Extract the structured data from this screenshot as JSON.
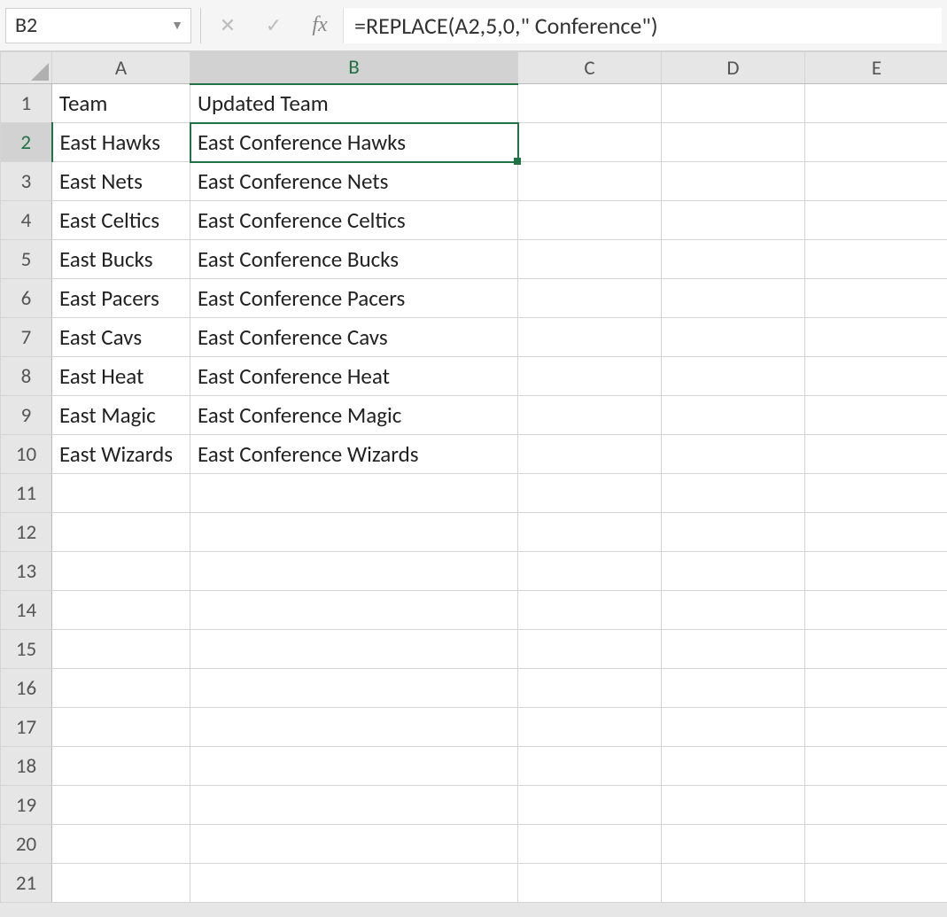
{
  "name_box": "B2",
  "formula": "=REPLACE(A2,5,0,\" Conference\")",
  "fx_label": "fx",
  "columns": [
    "A",
    "B",
    "C",
    "D",
    "E"
  ],
  "selected_cell": {
    "col": "B",
    "row": 2
  },
  "row_count": 21,
  "headers": {
    "A": "Team",
    "B": "Updated Team"
  },
  "rows": [
    {
      "n": 1,
      "A": "Team",
      "B": "Updated Team",
      "bold": true
    },
    {
      "n": 2,
      "A": "East Hawks",
      "B": "East Conference Hawks"
    },
    {
      "n": 3,
      "A": "East Nets",
      "B": "East Conference Nets"
    },
    {
      "n": 4,
      "A": "East Celtics",
      "B": "East Conference Celtics"
    },
    {
      "n": 5,
      "A": "East Bucks",
      "B": "East Conference Bucks"
    },
    {
      "n": 6,
      "A": "East Pacers",
      "B": "East Conference Pacers"
    },
    {
      "n": 7,
      "A": "East Cavs",
      "B": "East Conference Cavs"
    },
    {
      "n": 8,
      "A": "East Heat",
      "B": "East Conference Heat"
    },
    {
      "n": 9,
      "A": "East Magic",
      "B": "East Conference Magic"
    },
    {
      "n": 10,
      "A": "East Wizards",
      "B": "East Conference Wizards"
    },
    {
      "n": 11,
      "A": "",
      "B": ""
    },
    {
      "n": 12,
      "A": "",
      "B": ""
    },
    {
      "n": 13,
      "A": "",
      "B": ""
    },
    {
      "n": 14,
      "A": "",
      "B": ""
    },
    {
      "n": 15,
      "A": "",
      "B": ""
    },
    {
      "n": 16,
      "A": "",
      "B": ""
    },
    {
      "n": 17,
      "A": "",
      "B": ""
    },
    {
      "n": 18,
      "A": "",
      "B": ""
    },
    {
      "n": 19,
      "A": "",
      "B": ""
    },
    {
      "n": 20,
      "A": "",
      "B": ""
    },
    {
      "n": 21,
      "A": "",
      "B": ""
    }
  ]
}
